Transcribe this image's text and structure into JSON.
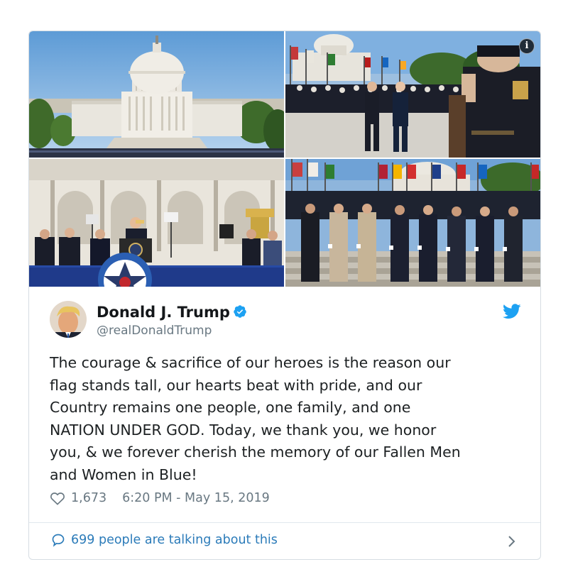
{
  "colors": {
    "twitter_blue": "#1da1f2",
    "link": "#2b7bb9",
    "text": "#1c2022",
    "secondary": "#697882"
  },
  "media": {
    "photos": [
      {
        "subject": "capitol-building"
      },
      {
        "subject": "officers-procession"
      },
      {
        "subject": "speaker-at-podium"
      },
      {
        "subject": "officers-lineup"
      }
    ],
    "info_icon_label": "i"
  },
  "author": {
    "name": "Donald J. Trump",
    "handle": "@realDonaldTrump",
    "verified": true,
    "avatar_icon": "profile-photo",
    "brand_icon": "twitter-bird-icon"
  },
  "tweet": {
    "text": "The courage & sacrifice of our heroes is the reason our\nflag stands tall, our hearts beat with pride, and our\nCountry remains one people, one family, and one\nNATION UNDER GOD. Today, we thank you, we honor\nyou, & we forever cherish the memory of our Fallen Men\nand Women in Blue!",
    "likes": "1,673",
    "timestamp": "6:20 PM - May 15, 2019"
  },
  "footer": {
    "talking_label": "699 people are talking about this"
  }
}
